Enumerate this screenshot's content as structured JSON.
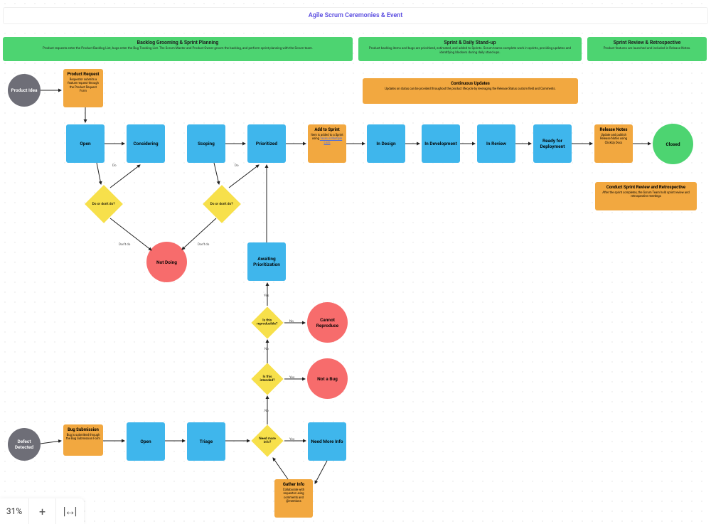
{
  "title": "Agile Scrum Ceremonies & Event",
  "bands": {
    "backlog": {
      "title": "Backlog Grooming & Sprint Planning",
      "desc": "Product requests enter the Product Backlog List, bugs enter the Bug Tracking List. The Scrum Master and Product Owner groom the backlog, and perform sprint planning with the Scrum team."
    },
    "sprint": {
      "title": "Sprint & Daily Stand-up",
      "desc": "Product backlog items and bugs are prioritized, estimated, and added to Sprints. Scrum teams complete work in sprints, providing updates and identifying blockers during daily stand-ups."
    },
    "review": {
      "title": "Sprint Review & Retrospective",
      "desc": "Product features are launched and included in Release Notes."
    }
  },
  "notes": {
    "productRequest": {
      "title": "Product Request",
      "desc": "Requestor submits a feature request through the Product Request Form"
    },
    "continuousUpdates": {
      "title": "Continuous Updates",
      "desc": "Updates on status can be provided throughout the product lifecycle by leveraging the Release Status custom field and Comments."
    },
    "addSprint": {
      "title": "Add to Sprint",
      "desc1": "Item is added to a Sprint using ",
      "desc_link": "Tasks in Multiple Lists"
    },
    "releaseNotes": {
      "title": "Release Notes",
      "desc": "Update and publish Release Notes using ClickUp Docs"
    },
    "conductReview": {
      "title": "Conduct Sprint Review and Retrospective",
      "desc": "After the sprint completes, the Scrum Team hold sprint review and retrospective meetings"
    },
    "bugSubmission": {
      "title": "Bug Submission",
      "desc": "Bug is submitted through the Bug Submission Form"
    },
    "gatherInfo": {
      "title": "Gather Info",
      "desc": "Collaborate with requestor using comments and @mentions"
    }
  },
  "nodes": {
    "productIdea": "Product Idea",
    "open": "Open",
    "considering": "Considering",
    "scoping": "Scoping",
    "prioritized": "Prioritized",
    "inDesign": "In Design",
    "inDevelopment": "In Development",
    "inReview": "In Review",
    "readyDeploy": "Ready for Deployment",
    "closed": "Closed",
    "notDoing": "Not Doing",
    "awaiting": "Awaiting Prioritization",
    "cannotReproduce": "Cannot Reproduce",
    "notABug": "Not a Bug",
    "defectDetected": "Defect Detected",
    "open2": "Open",
    "triage": "Triage",
    "needMoreInfoBox": "Need More Info"
  },
  "decisions": {
    "doOrDont1": "Do or don't do?",
    "doOrDont2": "Do or don't do?",
    "reproducible": "Is this reproducible?",
    "intended": "Is this intended?",
    "needMoreInfo": "Need more info?"
  },
  "labels": {
    "do": "Do",
    "dontDo": "Don't do",
    "yes": "Yes",
    "no": "No"
  },
  "zoom": {
    "pct": "31%"
  }
}
